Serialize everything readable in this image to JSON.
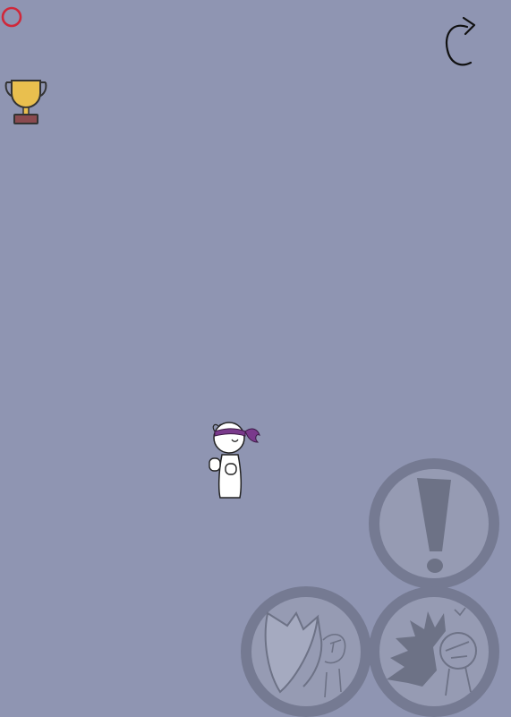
{
  "hud": {
    "record_icon": "record-ring-icon",
    "trophy_icon": "trophy-icon",
    "restart_icon": "restart-arrow-icon"
  },
  "player": {
    "character": "stickman-with-purple-headband"
  },
  "controls": [
    {
      "id": "alert",
      "icon": "exclamation-icon"
    },
    {
      "id": "block",
      "icon": "shield-block-icon"
    },
    {
      "id": "attack",
      "icon": "punch-burst-icon"
    }
  ],
  "colors": {
    "background": "#8f95b2",
    "button_ring": "#757a92",
    "button_fill": "#969bb3",
    "record": "#d0283a",
    "trophy_gold": "#e9bf4e",
    "trophy_base": "#8a4a4f",
    "headband": "#7a3a8c"
  }
}
